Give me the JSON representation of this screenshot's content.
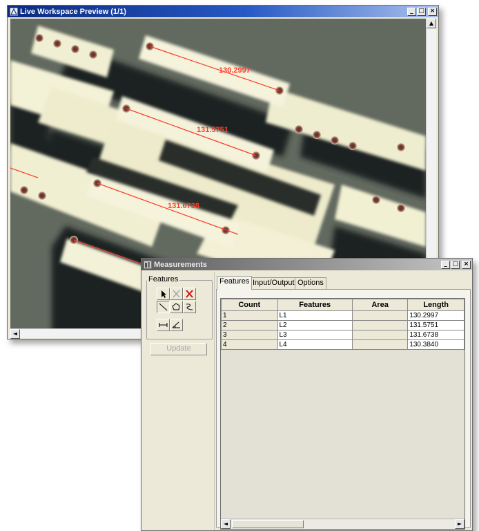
{
  "preview_window": {
    "title": "Live Workspace Preview (1/1)",
    "measurement_labels": [
      "130.2997",
      "131.5751",
      "131.6738"
    ],
    "controls": {
      "minimize": "_",
      "maximize": "□",
      "close": "×"
    },
    "scroll_up": "▲",
    "scroll_left": "◄"
  },
  "measurements_window": {
    "title": "Measurements",
    "controls": {
      "minimize": "_",
      "maximize": "□",
      "close": "×"
    },
    "features_group_label": "Features",
    "update_button": "Update",
    "tabs": [
      {
        "label": "Features",
        "active": true
      },
      {
        "label": "Input/Output",
        "active": false
      },
      {
        "label": "Options",
        "active": false
      }
    ],
    "table": {
      "columns": [
        "Count",
        "Features",
        "Area",
        "Length"
      ],
      "rows": [
        {
          "count": "1",
          "feature": "L1",
          "area": "",
          "length": "130.2997"
        },
        {
          "count": "2",
          "feature": "L2",
          "area": "",
          "length": "131.5751"
        },
        {
          "count": "3",
          "feature": "L3",
          "area": "",
          "length": "131.6738"
        },
        {
          "count": "4",
          "feature": "L4",
          "area": "",
          "length": "130.3840"
        }
      ]
    },
    "scroll_left": "◄",
    "scroll_right": "►"
  },
  "tools": [
    "select-arrow-icon",
    "delete-icon",
    "delete-all-icon",
    "line-tool-icon",
    "polygon-tool-icon",
    "freehand-tool-icon",
    "caliper-tool-icon",
    "angle-tool-icon"
  ],
  "colors": {
    "preview_title_start": "#0b2a80",
    "preview_title_end": "#a9c1ec",
    "measurement_line": "#ff3b2a",
    "delete_red": "#d01010"
  }
}
